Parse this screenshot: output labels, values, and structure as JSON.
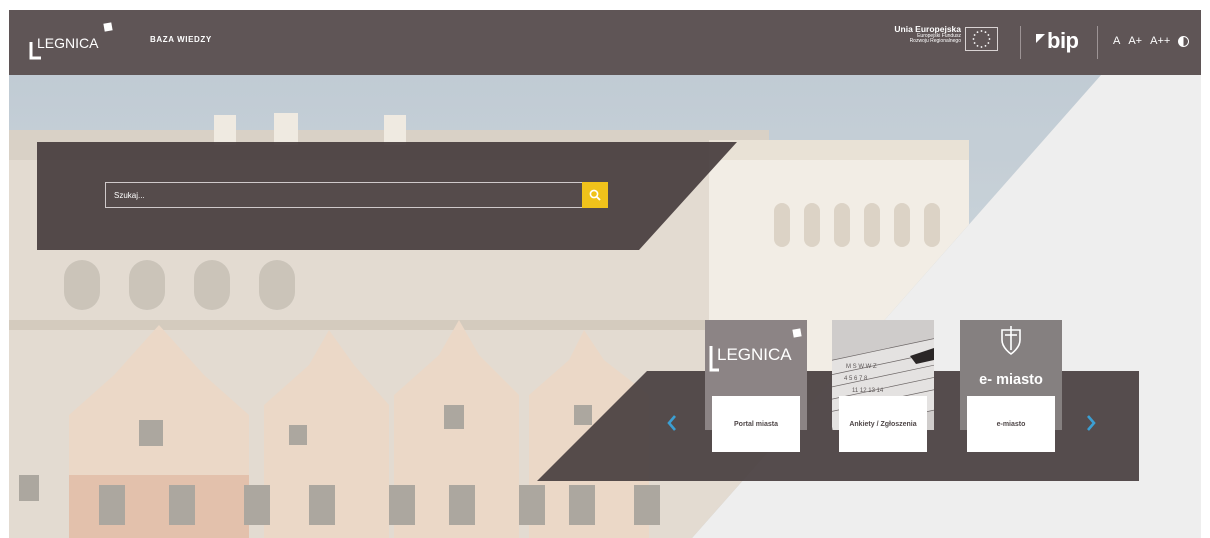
{
  "header": {
    "logo_text": "LEGNICA",
    "site_name": "BAZA WIEDZY",
    "eu": {
      "title": "Unia Europejska",
      "line1": "Europejski Fundusz",
      "line2": "Rozwoju Regionalnego"
    },
    "bip_label": "bip",
    "font_sizes": [
      "A",
      "A+",
      "A++"
    ],
    "contrast_icon": "contrast-icon"
  },
  "search": {
    "placeholder": "Szukaj...",
    "button_icon": "search-icon"
  },
  "carousel": {
    "prev_icon": "chevron-left-icon",
    "next_icon": "chevron-right-icon",
    "items": [
      {
        "label": "Portal miasta",
        "image_text": "LEGNICA"
      },
      {
        "label": "Ankiety / Zgłoszenia",
        "image_text": ""
      },
      {
        "label": "e-miasto",
        "image_text": "e- miasto"
      }
    ]
  },
  "colors": {
    "header_bg": "#5f5556",
    "accent_yellow": "#f0c21b",
    "arrow_blue": "#3b9fd3",
    "band_dark": "#42393a"
  }
}
